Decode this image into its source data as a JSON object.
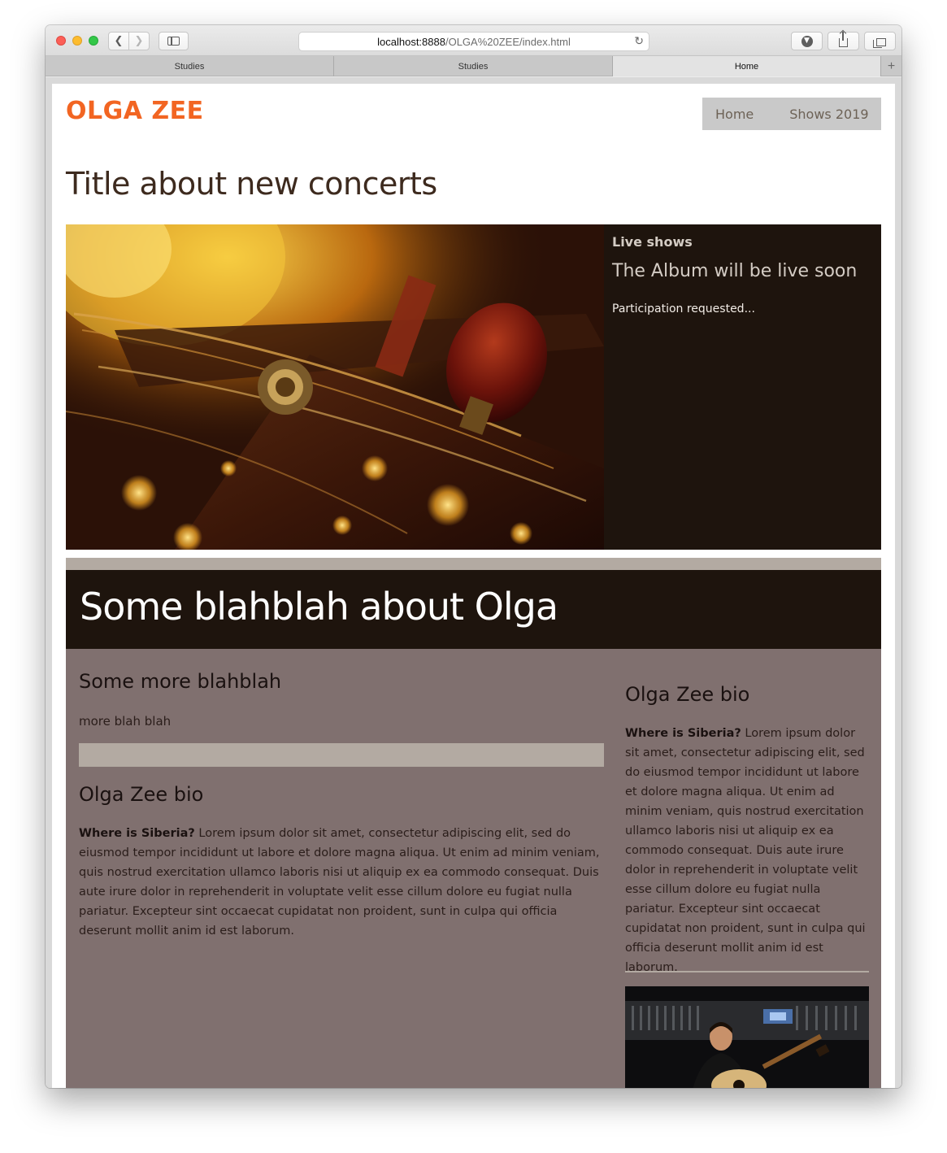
{
  "browser": {
    "url_host": "localhost:8888",
    "url_path": "/OLGA%20ZEE/index.html",
    "tabs": [
      {
        "label": "Studies",
        "active": false
      },
      {
        "label": "Studies",
        "active": false
      },
      {
        "label": "Home",
        "active": true
      }
    ]
  },
  "site": {
    "logo": "OLGA ZEE",
    "brand_color": "#f26522",
    "nav": [
      "Home",
      "Shows 2019"
    ]
  },
  "main": {
    "page_title": "Title about new concerts",
    "hero": {
      "kicker": "Live shows",
      "heading": "The Album will be live soon",
      "text": "Participation requested..."
    },
    "about": {
      "title": "Some blahblah about Olga",
      "sub_heading": "Some more blahblah",
      "sub_text": "more blah blah",
      "bio_heading": "Olga Zee bio",
      "bio_lead": "Where is Siberia?",
      "bio_body": " Lorem ipsum dolor sit amet, consectetur adipiscing elit, sed do eiusmod tempor incididunt ut labore et dolore magna aliqua. Ut enim ad minim veniam, quis nostrud exercitation ullamco laboris nisi ut aliquip ex ea commodo consequat. Duis aute irure dolor in reprehenderit in voluptate velit esse cillum dolore eu fugiat nulla pariatur. Excepteur sint occaecat cupidatat non proident, sunt in culpa qui officia deserunt mollit anim id est laborum."
    },
    "sidebar": {
      "bio_heading": "Olga Zee bio",
      "bio_lead": "Where is Siberia?",
      "bio_body": " Lorem ipsum dolor sit amet, consectetur adipiscing elit, sed do eiusmod tempor incididunt ut labore et dolore magna aliqua. Ut enim ad minim veniam, quis nostrud exercitation ullamco laboris nisi ut aliquip ex ea commodo consequat. Duis aute irure dolor in reprehenderit in voluptate velit esse cillum dolore eu fugiat nulla pariatur. Excepteur sint occaecat cupidatat non proident, sunt in culpa qui officia deserunt mollit anim id est laborum."
    }
  }
}
